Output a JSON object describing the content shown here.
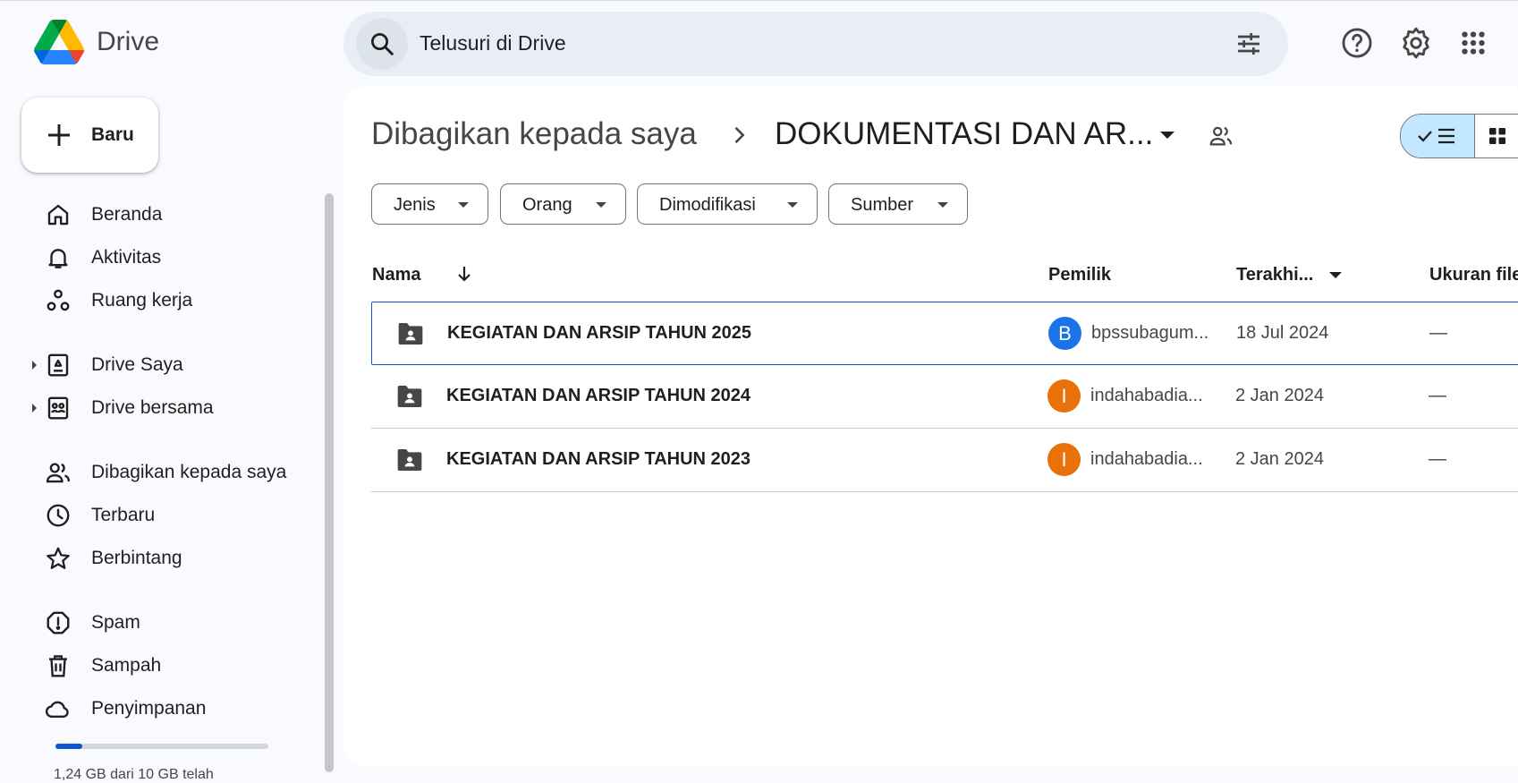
{
  "app": {
    "brand": "Drive",
    "logo_icon": "google-drive-logo"
  },
  "search": {
    "placeholder": "Telusuri di Drive"
  },
  "header": {
    "icons": [
      "help-icon",
      "settings-icon",
      "apps-grid-icon"
    ]
  },
  "sidebar": {
    "new_button": "Baru",
    "items": [
      {
        "label": "Beranda",
        "icon": "home-icon"
      },
      {
        "label": "Aktivitas",
        "icon": "bell-icon"
      },
      {
        "label": "Ruang kerja",
        "icon": "workspaces-icon"
      },
      {
        "label": "Drive Saya",
        "icon": "my-drive-icon"
      },
      {
        "label": "Drive bersama",
        "icon": "shared-drives-icon"
      },
      {
        "label": "Dibagikan kepada saya",
        "icon": "people-icon"
      },
      {
        "label": "Terbaru",
        "icon": "clock-icon"
      },
      {
        "label": "Berbintang",
        "icon": "star-icon"
      },
      {
        "label": "Spam",
        "icon": "spam-icon"
      },
      {
        "label": "Sampah",
        "icon": "trash-icon"
      },
      {
        "label": "Penyimpanan",
        "icon": "cloud-icon"
      }
    ],
    "storage_text": "1,24 GB dari 10 GB telah",
    "storage_used_fraction": 0.124
  },
  "breadcrumb": {
    "root": "Dibagikan kepada saya",
    "current": "DOKUMENTASI DAN AR..."
  },
  "filters": [
    "Jenis",
    "Orang",
    "Dimodifikasi",
    "Sumber"
  ],
  "table": {
    "headers": {
      "name": "Nama",
      "owner": "Pemilik",
      "modified": "Terakhi...",
      "size": "Ukuran file"
    },
    "rows": [
      {
        "name": "KEGIATAN DAN ARSIP TAHUN 2025",
        "avatar": "B",
        "avatar_color": "#1a73e8",
        "owner": "bpssubagum...",
        "modified": "18 Jul 2024",
        "size": "—",
        "selected": true
      },
      {
        "name": "KEGIATAN DAN ARSIP TAHUN 2024",
        "avatar": "I",
        "avatar_color": "#e8710a",
        "owner": "indahabadia...",
        "modified": "2 Jan 2024",
        "size": "—",
        "selected": false
      },
      {
        "name": "KEGIATAN DAN ARSIP TAHUN 2023",
        "avatar": "I",
        "avatar_color": "#e8710a",
        "owner": "indahabadia...",
        "modified": "2 Jan 2024",
        "size": "—",
        "selected": false
      }
    ]
  },
  "colors": {
    "accent": "#0b57d0",
    "sidebar_bg": "#f8fafd",
    "search_bg": "#e9eef6",
    "view_toggle_active": "#c2e7ff"
  }
}
